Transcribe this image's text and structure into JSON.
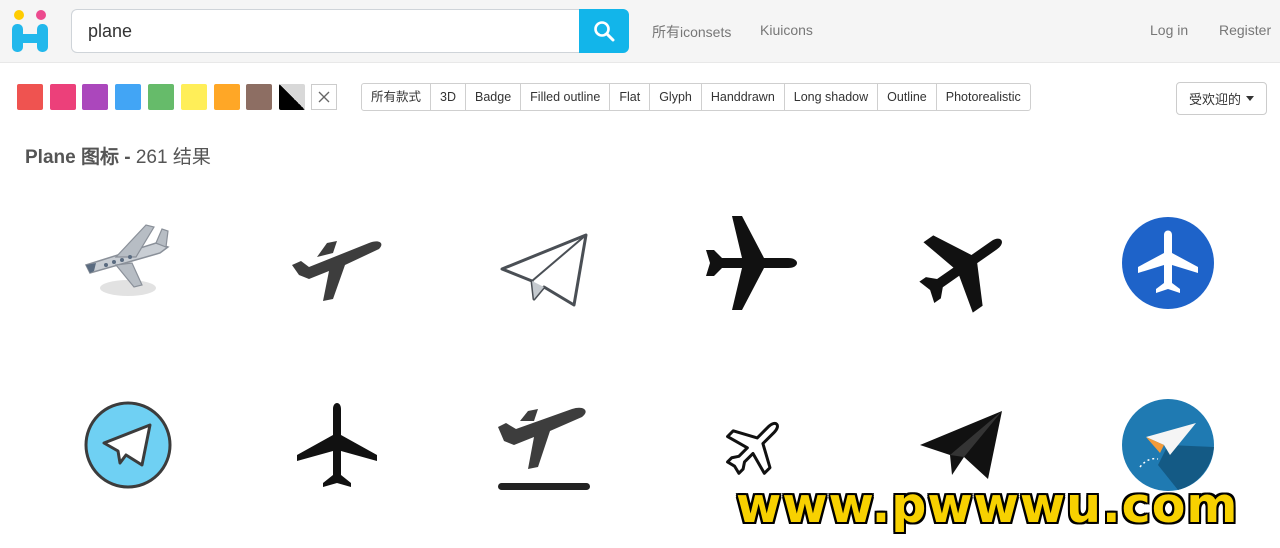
{
  "header": {
    "search_value": "plane",
    "nav": [
      "所有iconsets",
      "Kiuicons"
    ],
    "login": "Log in",
    "register": "Register"
  },
  "filters": {
    "colors": [
      "#ef5350",
      "#ec407a",
      "#ab47bc",
      "#42a5f5",
      "#66bb6a",
      "#ffee58",
      "#ffa726",
      "#8d6e63"
    ],
    "styles": [
      "所有款式",
      "3D",
      "Badge",
      "Filled outline",
      "Flat",
      "Glyph",
      "Handdrawn",
      "Long shadow",
      "Outline",
      "Photorealistic"
    ],
    "sort_label": "受欢迎的"
  },
  "results": {
    "query_title": "Plane 图标 - ",
    "count_text": "261 结果"
  },
  "icons": [
    "airplane-3d-icon",
    "takeoff-plane-icon",
    "paper-plane-outline-icon",
    "airplane-glyph-icon",
    "airplane-tilted-icon",
    "airplane-blue-circle-icon",
    "paper-plane-circle-icon",
    "airplane-topview-icon",
    "takeoff-runway-icon",
    "airplane-outline-icon",
    "paper-plane-filled-icon",
    "paper-plane-long-shadow-icon"
  ],
  "watermark": "www.pwwwu.com"
}
